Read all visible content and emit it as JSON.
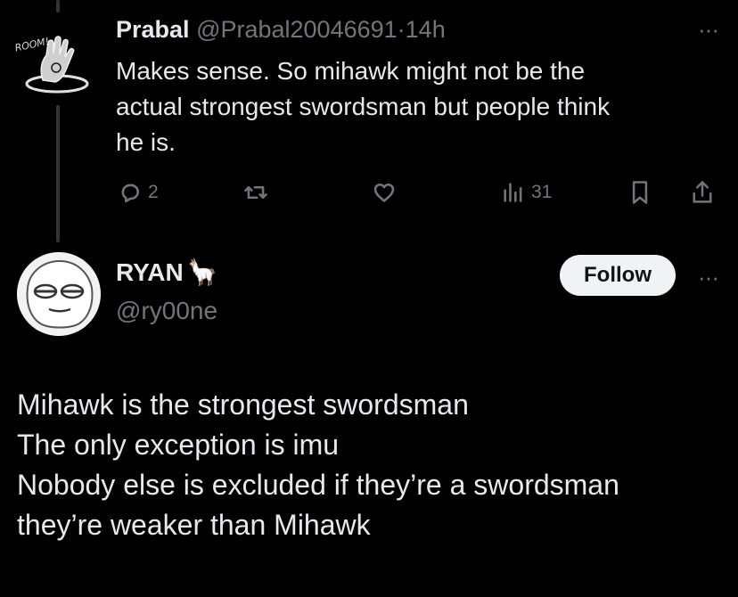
{
  "reply_tweet": {
    "avatar_text": "ROOM!",
    "author_name": "Prabal",
    "author_handle": "@Prabal20046691",
    "separator": "·",
    "time": "14h",
    "more": "···",
    "lines": [
      "Makes sense. So mihawk might not be the",
      "actual strongest swordsman but people think",
      "he is."
    ],
    "actions": {
      "reply_count": "2",
      "views_count": "31"
    }
  },
  "main_tweet": {
    "author_name": "RYAN",
    "author_emoji": "🦙",
    "author_handle": "@ry00ne",
    "follow_label": "Follow",
    "more": "···",
    "lines": [
      "Mihawk is the strongest swordsman",
      "The only exception is imu",
      "Nobody else is excluded if they’re a swordsman",
      "they’re weaker than Mihawk"
    ]
  },
  "colors": {
    "background": "#000000",
    "text": "#e7e9ea",
    "muted": "#71767b",
    "thread_line": "#333639",
    "follow_bg": "#eff3f4"
  }
}
